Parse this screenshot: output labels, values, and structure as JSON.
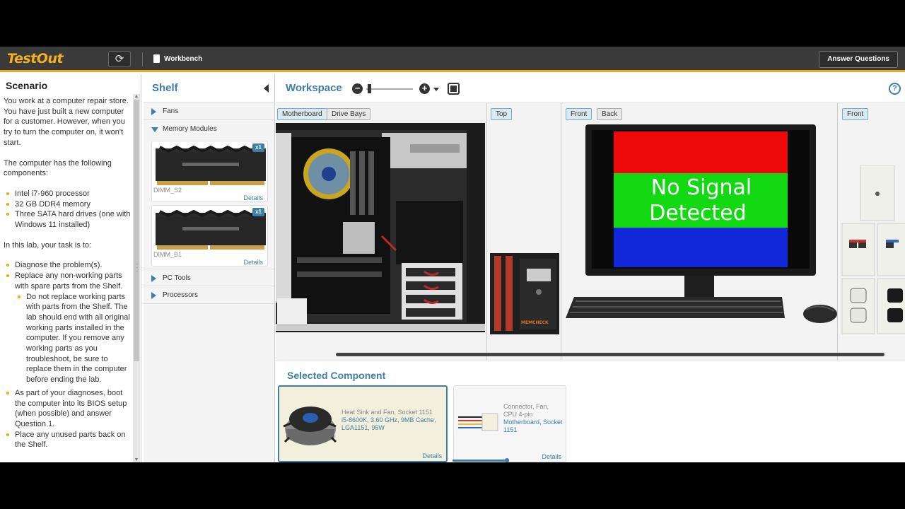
{
  "topbar": {
    "logo": "TestOut",
    "workbench_label": "Workbench",
    "answer_button": "Answer Questions"
  },
  "scenario": {
    "title": "Scenario",
    "para1": "You work at a computer repair store. You have just built a new computer for a customer. However, when you try to turn the computer on, it won't start.",
    "para2": "The computer has the following components:",
    "components": [
      "Intel i7-960 processor",
      "32 GB DDR4 memory",
      "Three SATA hard drives (one with Windows 11 installed)"
    ],
    "para3": "In this lab, your task is to:",
    "tasks": [
      "Diagnose the problem(s).",
      "Replace any non-working parts with spare parts from the Shelf."
    ],
    "subtask": "Do not replace working parts with parts from the Shelf. The lab should end with all original working parts installed in the computer. If you remove any working parts as you troubleshoot, be sure to replace them in the computer before ending the lab.",
    "tasks2": [
      "As part of your diagnoses, boot the computer into its BIOS setup (when possible) and answer Question 1.",
      "Place any unused parts back on the Shelf."
    ]
  },
  "shelf": {
    "title": "Shelf",
    "categories": [
      "Fans",
      "Memory Modules",
      "PC Tools",
      "Processors"
    ],
    "items": [
      {
        "count": "x1",
        "slot": "DIMM_S2",
        "details": "Details"
      },
      {
        "count": "x1",
        "slot": "DIMM_B1",
        "details": "Details"
      }
    ]
  },
  "workspace": {
    "title": "Workspace",
    "tabs": [
      "Motherboard",
      "Drive Bays",
      "Top",
      "Front",
      "Back",
      "Front"
    ],
    "monitor_text_line1": "No Signal",
    "monitor_text_line2": "Detected",
    "tester_brand": "MEMCHECK"
  },
  "selected": {
    "title": "Selected Component",
    "cards": [
      {
        "line1": "Heat Sink and Fan, Socket 1151",
        "line2": "i5-8600K, 3.60 GHz, 9MB Cache, LGA1151, 95W",
        "details": "Details"
      },
      {
        "line1": "Connector, Fan, CPU 4-pin",
        "line2": "Motherboard, Socket 1151",
        "details": "Details"
      }
    ]
  },
  "colors": {
    "accent": "#3d7fa6",
    "logo": "#f2b21e",
    "topbar": "#3a3a3a",
    "monitor_red": "#ee0a0a",
    "monitor_green": "#13d913",
    "monitor_blue": "#1128d9"
  }
}
